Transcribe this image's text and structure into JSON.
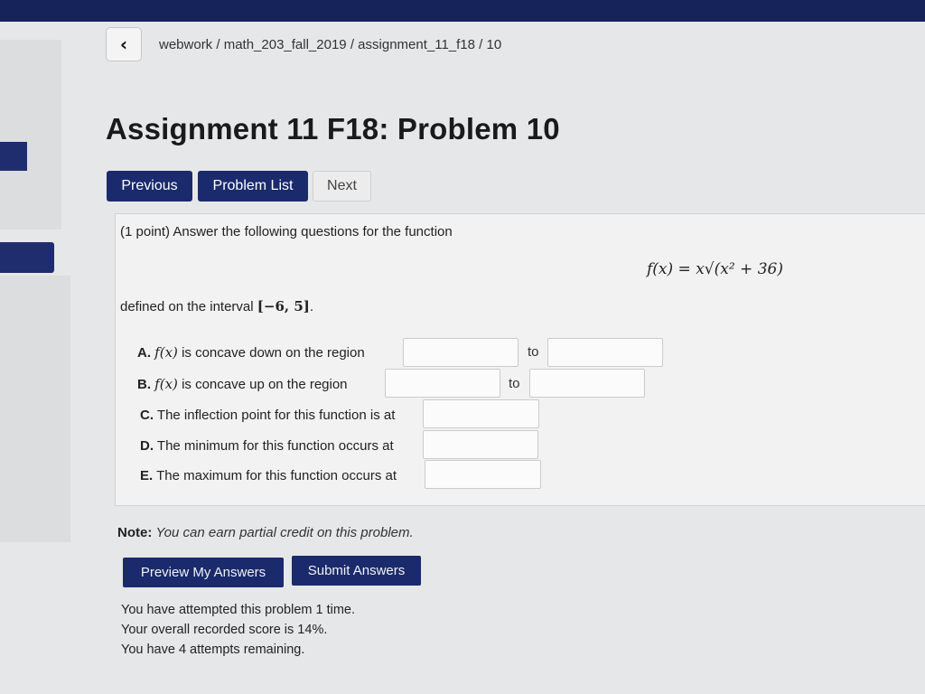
{
  "breadcrumb": {
    "parts": [
      "webwork",
      "math_203_fall_2019",
      "assignment_11_f18",
      "10"
    ],
    "separator": " / "
  },
  "back_icon": "chevron-left-icon",
  "page_title": "Assignment 11 F18: Problem 10",
  "nav": {
    "previous": "Previous",
    "problem_list": "Problem List",
    "next": "Next"
  },
  "problem": {
    "intro": "(1 point) Answer the following questions for the function",
    "formula": "f(x) = x√(x² + 36)",
    "interval_text": "defined on the interval",
    "interval": "[−6, 5]",
    "interval_end": ".",
    "questions": [
      {
        "letter": "A.",
        "text": "is concave down on the region",
        "fx": "f(x)",
        "to": "to"
      },
      {
        "letter": "B.",
        "text": "is concave up on the region",
        "fx": "f(x)",
        "to": "to"
      },
      {
        "letter": "C.",
        "text": "The inflection point for this function is at"
      },
      {
        "letter": "D.",
        "text": "The minimum for this function occurs at"
      },
      {
        "letter": "E.",
        "text": "The maximum for this function occurs at"
      }
    ]
  },
  "note": {
    "label": "Note:",
    "text": "You can earn partial credit on this problem."
  },
  "actions": {
    "preview": "Preview My Answers",
    "submit": "Submit Answers"
  },
  "status": {
    "attempted": "You have attempted this problem 1 time.",
    "score": "Your overall recorded score is 14%.",
    "remaining": "You have 4 attempts remaining."
  },
  "colors": {
    "primary": "#1a2a6c",
    "topbar": "#16235a",
    "panel": "#f2f2f2"
  }
}
